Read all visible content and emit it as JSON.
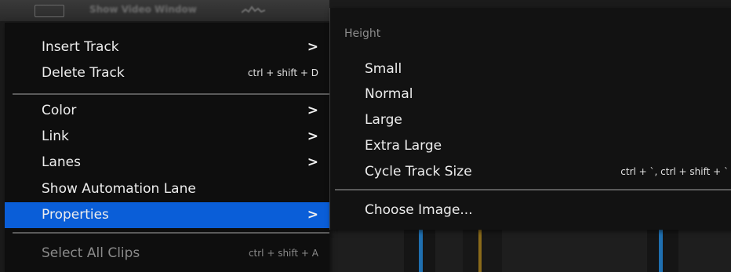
{
  "toolbar": {
    "show_video_label": "Show Video Window"
  },
  "context_menu": {
    "items": [
      {
        "label": "Insert Track",
        "shortcut": "",
        "arrow": ">"
      },
      {
        "label": "Delete Track",
        "shortcut": "ctrl + shift + D",
        "arrow": ""
      },
      {
        "label": "Color",
        "shortcut": "",
        "arrow": ">"
      },
      {
        "label": "Link",
        "shortcut": "",
        "arrow": ">"
      },
      {
        "label": "Lanes",
        "shortcut": "",
        "arrow": ">"
      },
      {
        "label": "Show Automation Lane",
        "shortcut": "",
        "arrow": ""
      },
      {
        "label": "Properties",
        "shortcut": "",
        "arrow": ">"
      },
      {
        "label": "Select All Clips",
        "shortcut": "ctrl + shift + A",
        "arrow": ""
      }
    ]
  },
  "submenu": {
    "header": "Height",
    "items": [
      {
        "label": "Small",
        "shortcut": ""
      },
      {
        "label": "Normal",
        "shortcut": ""
      },
      {
        "label": "Large",
        "shortcut": ""
      },
      {
        "label": "Extra Large",
        "shortcut": ""
      },
      {
        "label": "Cycle Track Size",
        "shortcut": "ctrl + `, ctrl + shift + `"
      },
      {
        "label": "Choose Image...",
        "shortcut": ""
      }
    ]
  },
  "colors": {
    "selection": "#0a5ed8",
    "menu_bg": "#0e0e0e",
    "marker_blue": "#1f6fb0",
    "marker_gold": "#8a6a1a"
  },
  "icons": [
    "film-icon",
    "waveform-icon",
    "chevron-right-icon"
  ]
}
